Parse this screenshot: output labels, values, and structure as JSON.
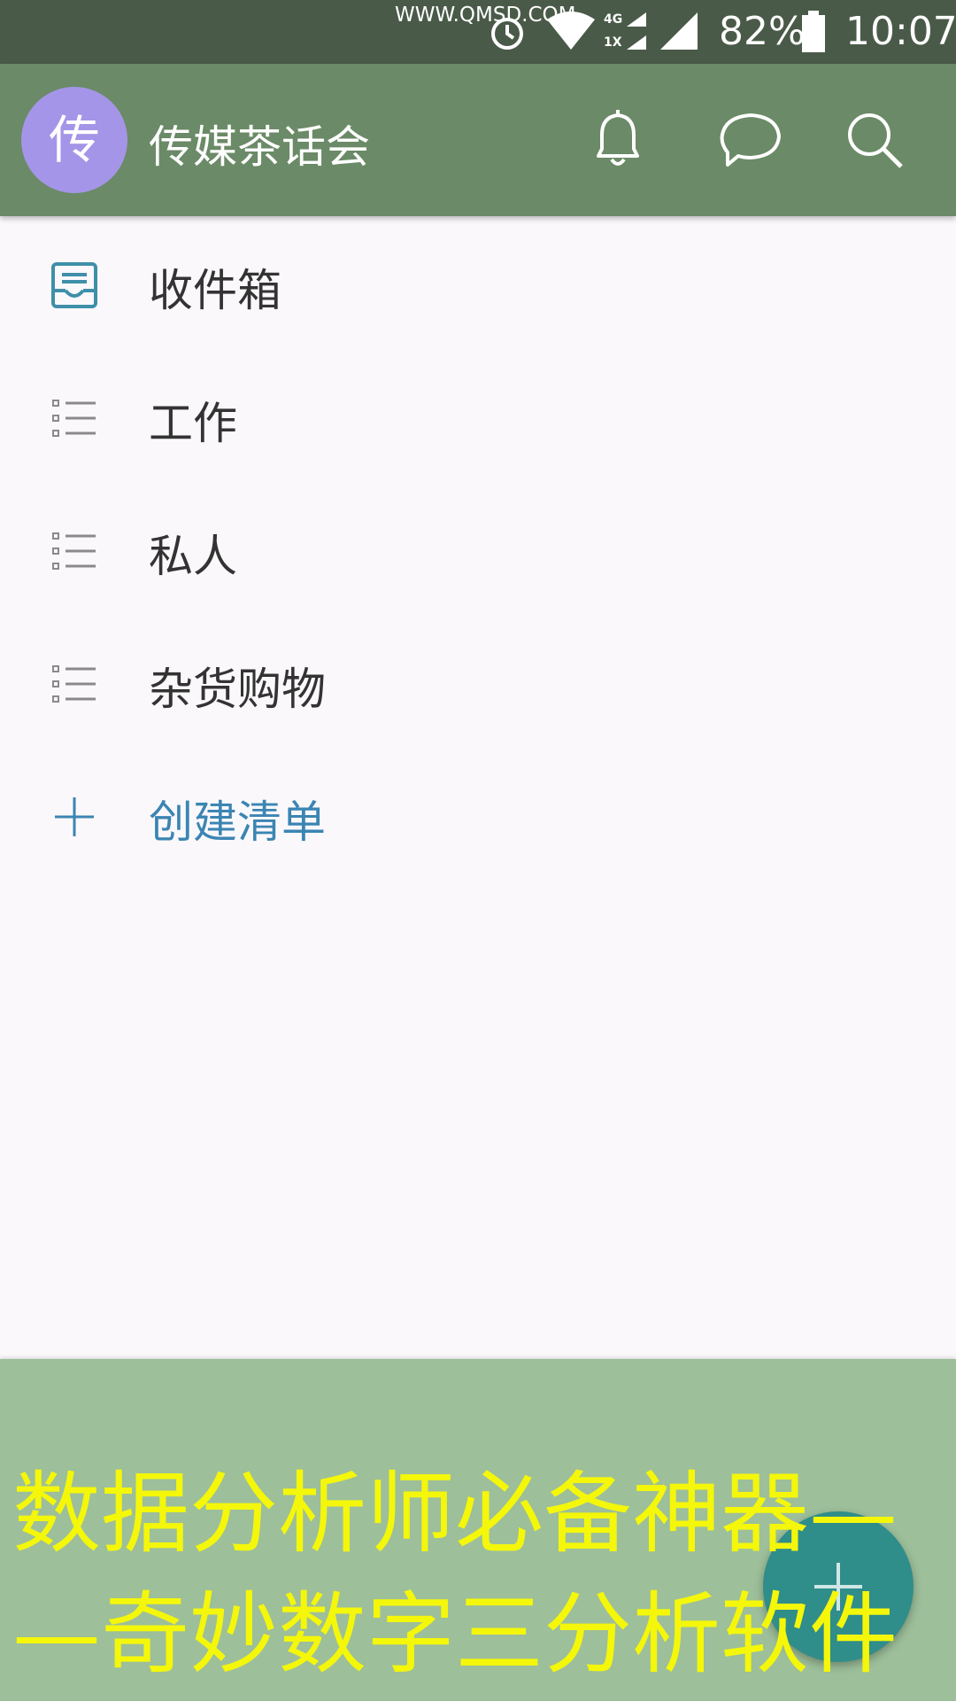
{
  "status_bar": {
    "watermark": "WWW.QMSD.COM",
    "network_top": "4G",
    "network_bottom": "1X",
    "battery": "82%",
    "time": "10:07",
    "icons": [
      "alarm-icon",
      "wifi-icon",
      "cell-signal-icon",
      "battery-icon"
    ]
  },
  "app_bar": {
    "avatar_letter": "传",
    "title": "传媒茶话会",
    "actions": [
      "bell-icon",
      "chat-icon",
      "search-icon"
    ],
    "colors": {
      "app_bar": "#6b8a67",
      "avatar": "#a595e8"
    }
  },
  "lists": [
    {
      "label": "收件箱",
      "icon": "inbox-icon"
    },
    {
      "label": "工作",
      "icon": "list-icon"
    },
    {
      "label": "私人",
      "icon": "list-icon"
    },
    {
      "label": "杂货购物",
      "icon": "list-icon"
    },
    {
      "label": "创建清单",
      "icon": "plus-icon"
    }
  ],
  "caption": {
    "line1": "数据分析师必备神器—",
    "line2": "—奇妙数字三分析软件",
    "color": "#f4f70a"
  },
  "fab": {
    "icon": "plus-icon",
    "color": "#2f8d8a"
  }
}
